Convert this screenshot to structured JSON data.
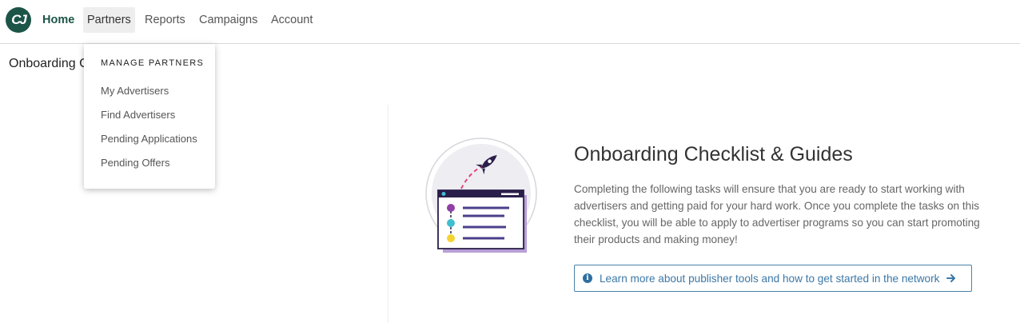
{
  "nav": {
    "logo_text": "CJ",
    "items": [
      {
        "label": "Home"
      },
      {
        "label": "Partners"
      },
      {
        "label": "Reports"
      },
      {
        "label": "Campaigns"
      },
      {
        "label": "Account"
      }
    ]
  },
  "page": {
    "title": "Onboarding C"
  },
  "partners_menu": {
    "header": "MANAGE PARTNERS",
    "items": [
      {
        "label": "My Advertisers"
      },
      {
        "label": "Find Advertisers"
      },
      {
        "label": "Pending Applications"
      },
      {
        "label": "Pending Offers"
      }
    ]
  },
  "checklist": {
    "title": "Onboarding Checklist & Guides",
    "description": "Completing the following tasks will ensure that you are ready to start working with advertisers and getting paid for your hard work. Once you complete the tasks on this checklist, you will be able to apply to advertiser programs so you can start promoting their products and making money!",
    "learn_more": "Learn more about publisher tools and how to get started in the network",
    "icons": {
      "info": "info-circle-icon",
      "arrow": "arrow-right-icon",
      "illustration": "rocket-checklist-illustration"
    }
  },
  "colors": {
    "brand": "#1c5548",
    "link": "#3c78a6",
    "illustration_purple": "#8f3fa6",
    "illustration_teal": "#3fbfcf",
    "illustration_yellow": "#f5d232"
  }
}
